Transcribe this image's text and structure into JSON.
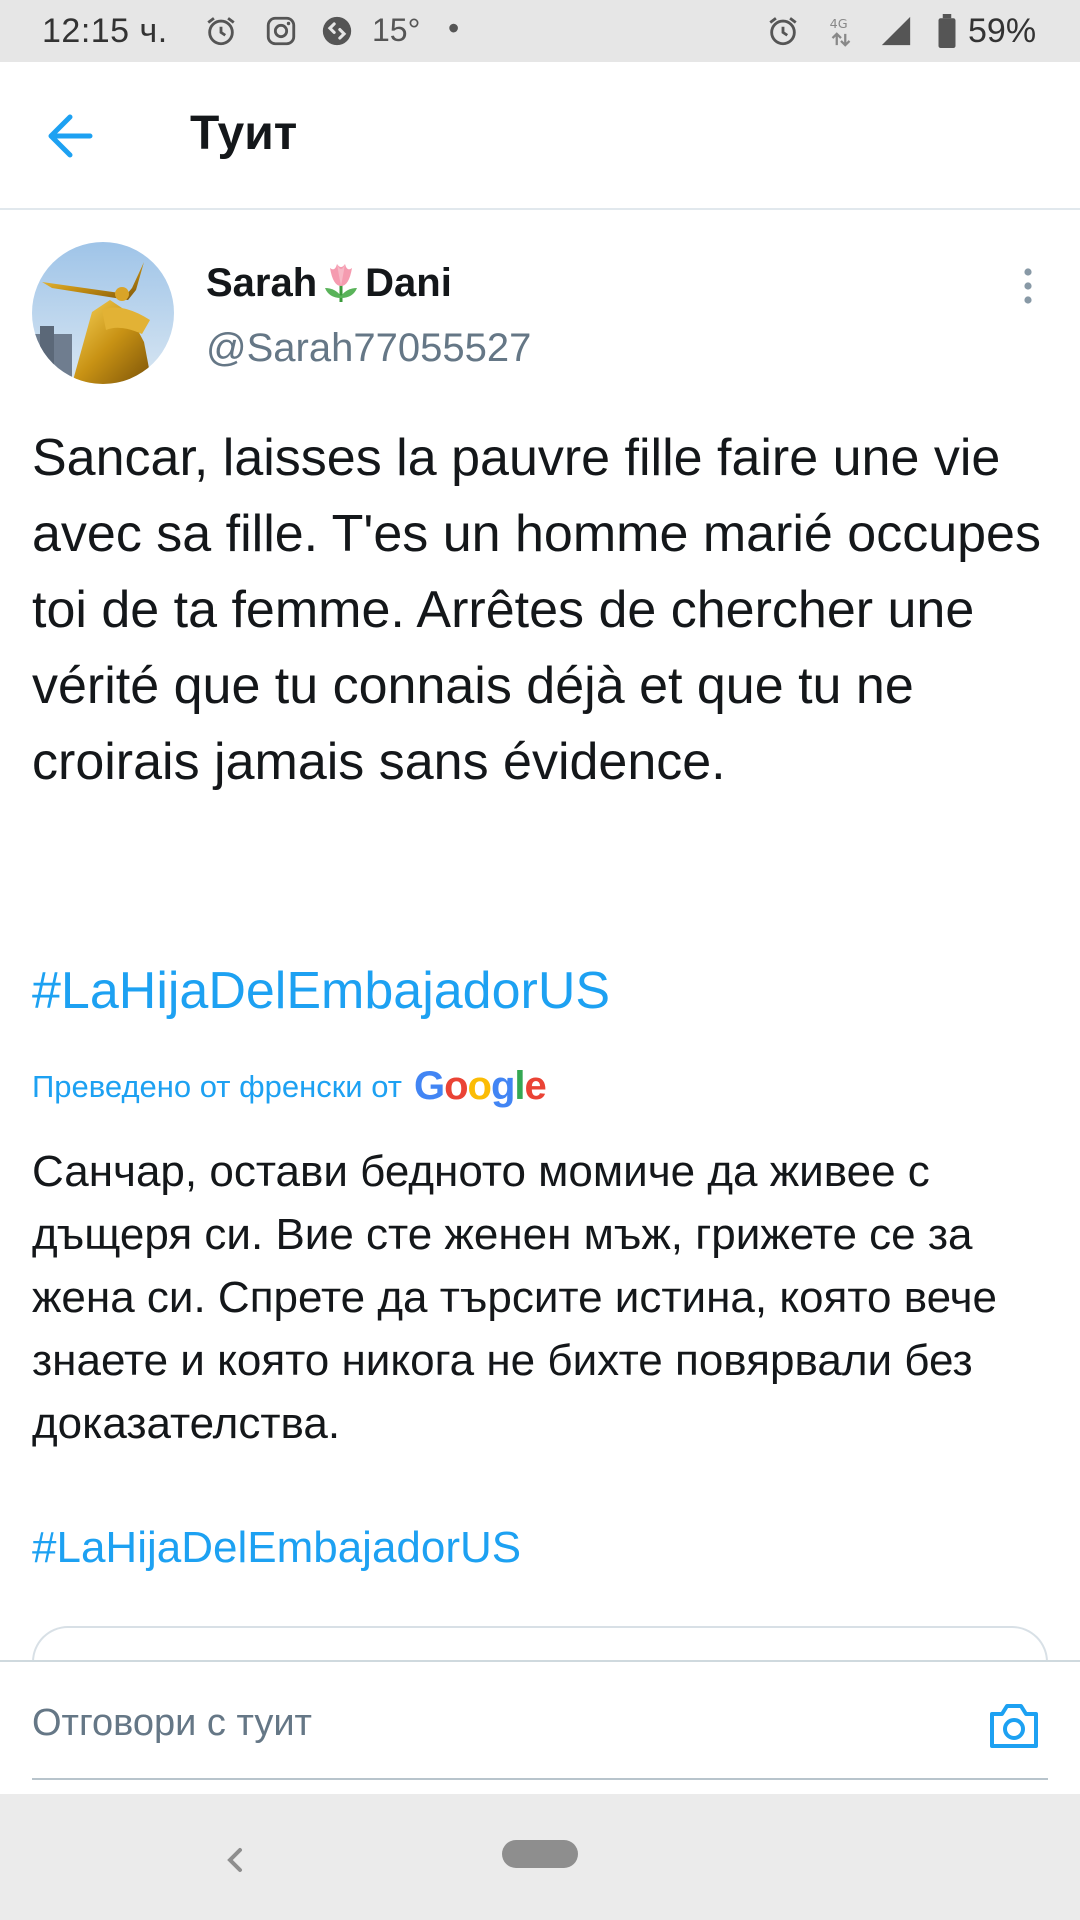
{
  "status_bar": {
    "time": "12:15 ч.",
    "temperature": "15°",
    "dot": "•",
    "network": "4G",
    "battery": "59%",
    "icons": [
      "alarm-icon",
      "instagram-icon",
      "shazam-icon",
      "alarm-icon",
      "network-4g-icon",
      "signal-icon",
      "battery-icon"
    ]
  },
  "app_bar": {
    "title": "Туит",
    "back_icon": "arrow-left-icon"
  },
  "tweet": {
    "author": {
      "name_part1": "Sarah",
      "name_emoji": "tulip-emoji",
      "name_part2": "Dani",
      "handle": "@Sarah77055527"
    },
    "text": "Sancar, laisses la pauvre fille faire une vie avec sa fille. T'es un homme marié occupes toi de ta femme. Arrêtes de chercher une vérité que tu connais déjà et que tu ne croirais jamais sans évidence.",
    "hashtag": "#LaHijaDelEmbajadorUS",
    "translated_label": "Преведено от френски от",
    "translation_provider": "Google",
    "translated_text": "Санчар, остави бедното момиче да живее с дъщеря си. Вие сте женен мъж, грижете се за жена си. Спрете да търсите истина, която вече знаете и която никога не бихте повярвали без доказателства.",
    "translated_hashtag": "#LaHijaDelEmbajadorUS"
  },
  "reply": {
    "placeholder": "Отговори с туит",
    "camera_icon": "camera-icon"
  },
  "colors": {
    "accent": "#1da1f2",
    "text": "#14171a",
    "secondary": "#657786",
    "status_bar_bg": "#e6e6e6",
    "nav_bar_bg": "#ebebeb"
  }
}
